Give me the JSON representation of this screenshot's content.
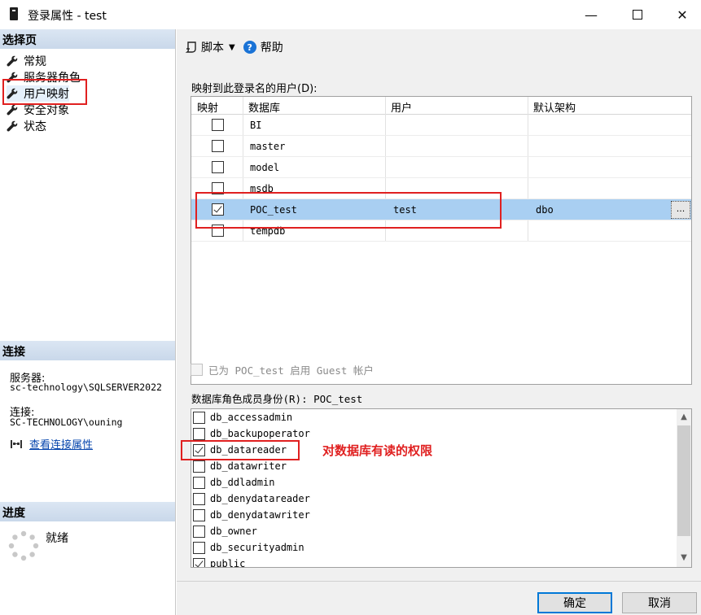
{
  "window": {
    "title": "登录属性 - test",
    "minimize": "—",
    "close": "✕"
  },
  "left": {
    "select_page_header": "选择页",
    "nav_items": [
      "常规",
      "服务器角色",
      "用户映射",
      "安全对象",
      "状态"
    ],
    "connection_header": "连接",
    "server_label": "服务器:",
    "server_value": "sc-technology\\SQLSERVER2022",
    "connection_label": "连接:",
    "connection_value": "SC-TECHNOLOGY\\ouning",
    "view_connection_props": "查看连接属性",
    "progress_header": "进度",
    "status": "就绪"
  },
  "toolbar": {
    "script_label": "脚本",
    "dropdown_arrow": "▼",
    "help_icon_glyph": "?",
    "help_label": "帮助"
  },
  "mapping": {
    "label": "映射到此登录名的用户(D):",
    "columns": [
      "映射",
      "数据库",
      "用户",
      "默认架构"
    ],
    "rows": [
      {
        "checked": false,
        "database": "BI",
        "user": "",
        "schema": ""
      },
      {
        "checked": false,
        "database": "master",
        "user": "",
        "schema": ""
      },
      {
        "checked": false,
        "database": "model",
        "user": "",
        "schema": ""
      },
      {
        "checked": false,
        "database": "msdb",
        "user": "",
        "schema": ""
      },
      {
        "checked": true,
        "database": "POC_test",
        "user": "test",
        "schema": "dbo"
      },
      {
        "checked": false,
        "database": "tempdb",
        "user": "",
        "schema": ""
      }
    ],
    "ellipsis": "..."
  },
  "guest": {
    "label": "已为 POC_test 启用 Guest 帐户"
  },
  "roles": {
    "label": "数据库角色成员身份(R): POC_test",
    "items": [
      {
        "name": "db_accessadmin",
        "checked": false
      },
      {
        "name": "db_backupoperator",
        "checked": false
      },
      {
        "name": "db_datareader",
        "checked": true
      },
      {
        "name": "db_datawriter",
        "checked": false
      },
      {
        "name": "db_ddladmin",
        "checked": false
      },
      {
        "name": "db_denydatareader",
        "checked": false
      },
      {
        "name": "db_denydatawriter",
        "checked": false
      },
      {
        "name": "db_owner",
        "checked": false
      },
      {
        "name": "db_securityadmin",
        "checked": false
      },
      {
        "name": "public",
        "checked": true
      }
    ],
    "scroll_up": "▲",
    "scroll_down": "▼"
  },
  "annotation": {
    "text": "对数据库有读的权限"
  },
  "buttons": {
    "ok": "确定",
    "cancel": "取消"
  },
  "colors": {
    "selection": "#a9cff2",
    "annotation_red": "#e02020",
    "section_header": "#c9d8ea",
    "link": "#0645ad"
  }
}
